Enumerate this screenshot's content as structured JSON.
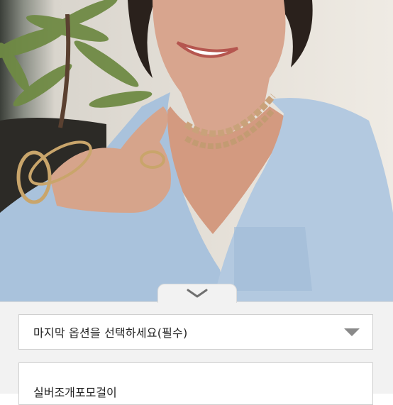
{
  "product": {
    "image_name": "model-wearing-shell-choker-and-bangles"
  },
  "option_sheet": {
    "collapse_icon": "chevron-down-icon",
    "select_placeholder": "마지막 옵션을 선택하세요(필수)",
    "select_icon": "triangle-down-icon",
    "selected_item_name": "실버조개포모걸이"
  },
  "colors": {
    "sheet_background": "#f2f2f2",
    "border": "#cfcfcf",
    "text": "#222222",
    "caret": "#8a8a8a"
  }
}
